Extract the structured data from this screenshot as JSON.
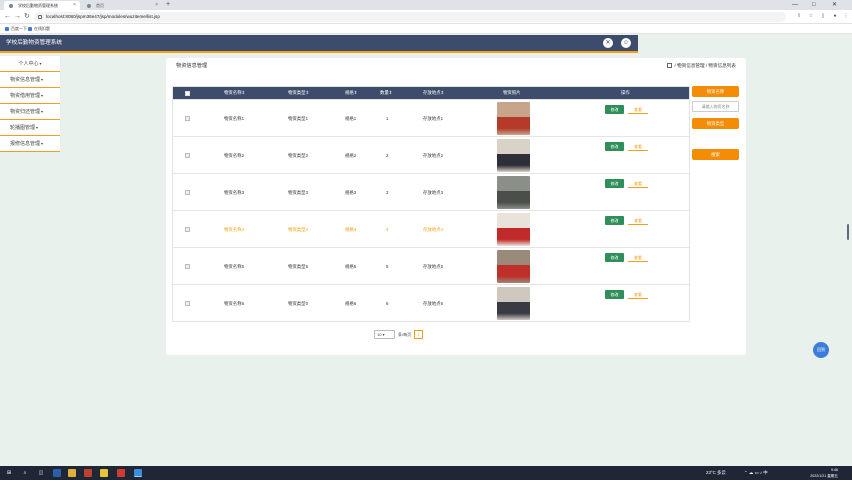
{
  "browser": {
    "tabs": [
      {
        "label": "学校后勤物资管理系统",
        "active": true
      },
      {
        "label": "首页",
        "active": false
      }
    ],
    "url": "localhost:8080/jspm36e47/jsp/modules/wuziteme/list.jsp",
    "bookmarks": [
      "百度一下",
      "在线扣题"
    ],
    "window_controls": [
      "—",
      "□",
      "✕"
    ]
  },
  "app": {
    "title": "学校后勤物资管理系统",
    "header_icons": [
      "close-icon",
      "user-icon"
    ],
    "accent_color": "#f0a018",
    "header_color": "#3d4c6b"
  },
  "sidebar": {
    "items": [
      {
        "label": "个人中心"
      },
      {
        "label": "物资信息管理"
      },
      {
        "label": "物资借用管理"
      },
      {
        "label": "物资归还管理"
      },
      {
        "label": "轮播图管理"
      },
      {
        "label": "报修信息管理"
      }
    ]
  },
  "main": {
    "page_title": "物资信息管理",
    "breadcrumb": "/ 物资信息管理 / 物资信息列表",
    "table": {
      "columns": [
        "物资名称⇕",
        "物资类型⇕",
        "规格⇕",
        "数量⇕",
        "存放地点⇕",
        "物资照片",
        "操作"
      ],
      "rows": [
        {
          "name": "物资名称1",
          "type": "物资类型1",
          "spec": "规格1",
          "qty": "1",
          "place": "存放地点1",
          "photo_colors": [
            "#c6a58a",
            "#b53a2a"
          ],
          "highlight": false
        },
        {
          "name": "物资名称2",
          "type": "物资类型2",
          "spec": "规格2",
          "qty": "2",
          "place": "存放地点2",
          "photo_colors": [
            "#d9d2c6",
            "#2f2f3a"
          ],
          "highlight": false
        },
        {
          "name": "物资名称3",
          "type": "物资类型3",
          "spec": "规格3",
          "qty": "3",
          "place": "存放地点3",
          "photo_colors": [
            "#8a9088",
            "#4a4f4a"
          ],
          "highlight": false
        },
        {
          "name": "物资名称4",
          "type": "物资类型4",
          "spec": "规格4",
          "qty": "4",
          "place": "存放地点4",
          "photo_colors": [
            "#e8e4dc",
            "#c02a2a"
          ],
          "highlight": true
        },
        {
          "name": "物资名称5",
          "type": "物资类型5",
          "spec": "规格5",
          "qty": "5",
          "place": "存放地点5",
          "photo_colors": [
            "#9a8a7a",
            "#c0302a"
          ],
          "highlight": false
        },
        {
          "name": "物资名称6",
          "type": "物资类型0",
          "spec": "规格6",
          "qty": "6",
          "place": "存放地点6",
          "photo_colors": [
            "#cfc8bf",
            "#3a3a44"
          ],
          "highlight": false
        }
      ],
      "action_modify": "修改",
      "action_view": "查看"
    },
    "pager": {
      "page_size": "10",
      "page_size_label": "条/每页",
      "current_page": "1"
    }
  },
  "search_panel": {
    "label1": "物资名称",
    "input_placeholder": "请输入物资名称",
    "label2": "物资类型",
    "search_button": "搜索"
  },
  "bubble": "回到",
  "taskbar": {
    "weather": "23°C  多云",
    "time": "9:46",
    "date": "2022/1/21 星期五"
  }
}
